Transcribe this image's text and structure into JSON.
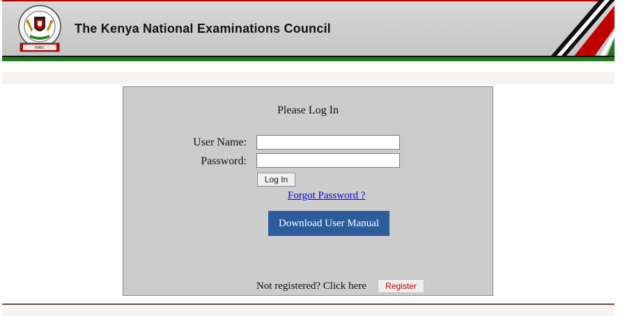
{
  "header": {
    "title": "The Kenya National Examinations Council",
    "logo_icon": "coat-of-arms-icon",
    "logo_text": "THE KENYA NATIONAL EXAMINATIONS COUNCIL",
    "colors": {
      "green": "#1f7a1f",
      "red": "#b20000",
      "black": "#111111"
    }
  },
  "login": {
    "heading": "Please Log In",
    "username_label": "User Name:",
    "password_label": "Password:",
    "username_value": "",
    "password_value": "",
    "login_button": "Log In",
    "forgot_link": "Forgot Password ?",
    "download_button": "Download User Manual",
    "not_registered_text": "Not registered? Click here",
    "register_button": "Register"
  },
  "colors": {
    "panel_bg": "#cccccc",
    "download_button_bg": "#2c5c9c",
    "register_text": "#c00000",
    "link": "#0000ee"
  }
}
